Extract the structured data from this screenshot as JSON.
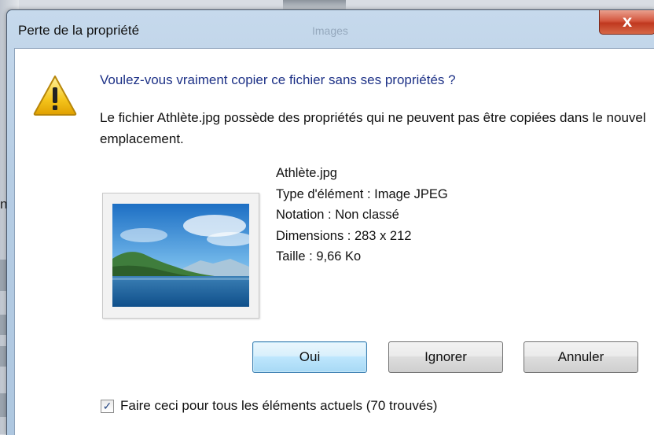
{
  "window": {
    "title": "Perte de la propriété",
    "background_title": "Images",
    "close_label": "X"
  },
  "icons": {
    "warning": "warning-icon",
    "close": "close-icon",
    "check": "checkmark-icon"
  },
  "message": {
    "question": "Voulez-vous vraiment copier ce fichier sans ses propriétés ?",
    "description": "Le fichier Athlète.jpg possède des propriétés qui ne peuvent pas être copiées dans le nouvel emplacement."
  },
  "file": {
    "name": "Athlète.jpg",
    "type": "Type d'élément : Image JPEG",
    "rating": "Notation : Non classé",
    "dimensions": "Dimensions : 283 x 212",
    "size": "Taille : 9,66 Ko"
  },
  "buttons": {
    "yes": "Oui",
    "skip": "Ignorer",
    "cancel": "Annuler"
  },
  "checkbox": {
    "label": "Faire ceci pour tous les éléments actuels (70 trouvés)",
    "checked": true
  },
  "background": {
    "stray_text": "n"
  },
  "colors": {
    "question_text": "#1e3287",
    "close_button": "#c9472c",
    "default_button_border": "#3c7fb1"
  }
}
